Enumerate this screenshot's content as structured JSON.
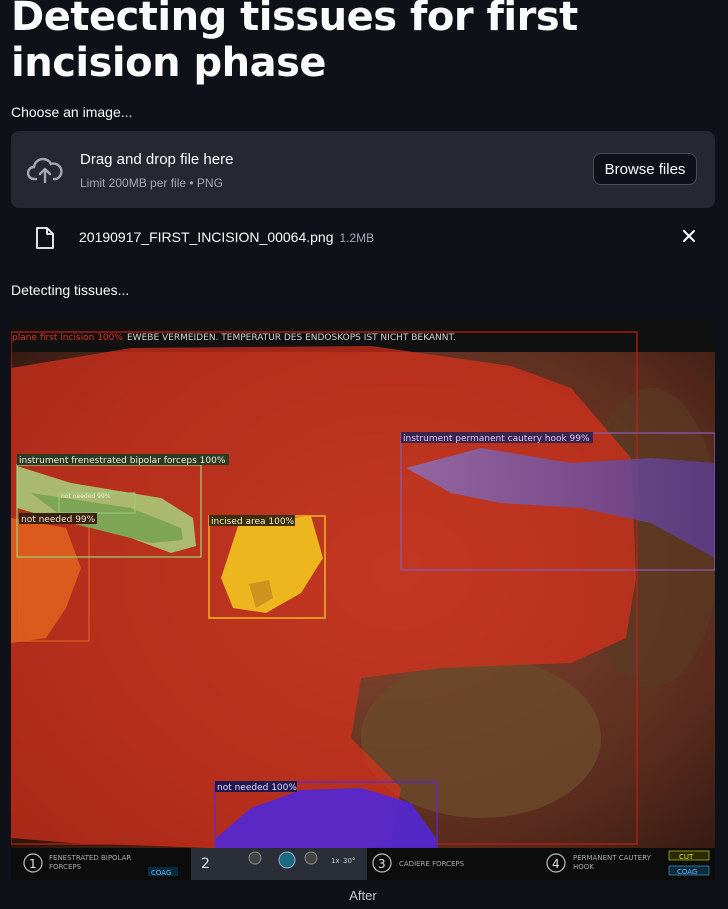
{
  "page": {
    "title": "Detecting tissues for first incision phase",
    "choose_label": "Choose an image...",
    "status_label": "Detecting tissues...",
    "caption": "After"
  },
  "uploader": {
    "drop_text": "Drag and drop file here",
    "limit_text": "Limit 200MB per file • PNG",
    "browse_label": "Browse files",
    "icon": "cloud-upload-icon"
  },
  "file": {
    "name": "20190917_FIRST_INCISION_00064.png",
    "size": "1.2MB",
    "icon": "file-icon",
    "close_icon": "close-icon"
  },
  "image": {
    "banner_text": "EWEBE VERMEIDEN. TEMPERATUR DES ENDOSKOPS IST NICHT BEKANNT.",
    "detections": [
      {
        "label": "plane first incision 100%",
        "color": "#e0301e"
      },
      {
        "label": "instrument permanent cautery hook 99%",
        "color": "#a35fd0"
      },
      {
        "label": "instrument frenestrated bipolar forceps 100%",
        "color": "#9bd17a"
      },
      {
        "label": "not needed 99%",
        "color": "#9bd17a"
      },
      {
        "label": "not needed 99%",
        "color": "#e06020"
      },
      {
        "label": "incised area 100%",
        "color": "#f0c020"
      },
      {
        "label": "not needed 100%",
        "color": "#5a2ad8"
      }
    ],
    "hud": {
      "slot1_num": "1",
      "slot1_label_a": "FENESTRATED BIPOLAR",
      "slot1_label_b": "FORCEPS",
      "slot1_tag": "COAG",
      "slot2_num": "2",
      "slot2_zoom": "1x",
      "slot2_angle": "30°",
      "slot3_num": "3",
      "slot3_label": "CADIERE FORCEPS",
      "slot4_num": "4",
      "slot4_label_a": "PERMANENT CAUTERY",
      "slot4_label_b": "HOOK",
      "slot4_tag_cut": "CUT",
      "slot4_tag_coag": "COAG"
    }
  }
}
